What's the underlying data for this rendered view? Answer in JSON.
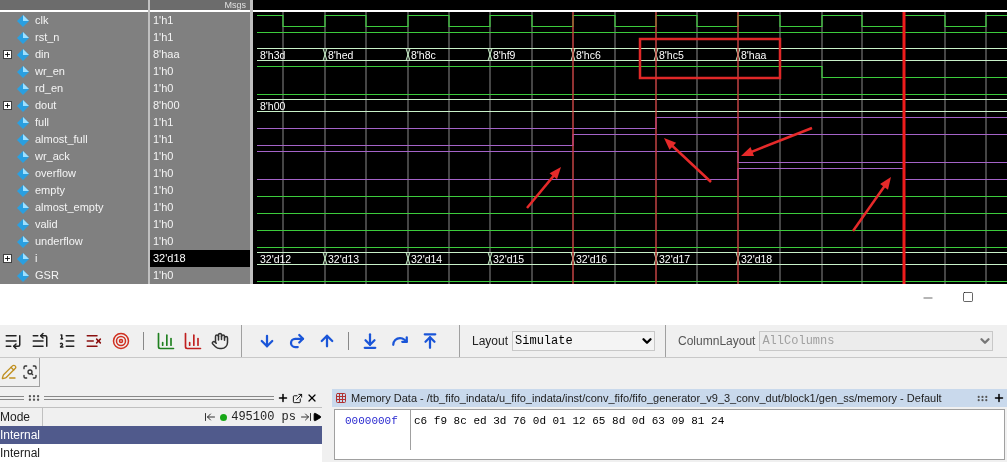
{
  "wave": {
    "header": "Msgs",
    "signals": [
      {
        "name": "clk",
        "value": "1'h1",
        "expandable": false,
        "selected": false
      },
      {
        "name": "rst_n",
        "value": "1'h1",
        "expandable": false,
        "selected": false
      },
      {
        "name": "din",
        "value": "8'haa",
        "expandable": true,
        "selected": false,
        "segments": [
          "8'h3d",
          "8'hed",
          "8'h8c",
          "8'hf9",
          "8'hc6",
          "8'hc5",
          "8'haa"
        ]
      },
      {
        "name": "wr_en",
        "value": "1'h0",
        "expandable": false,
        "selected": false
      },
      {
        "name": "rd_en",
        "value": "1'h0",
        "expandable": false,
        "selected": false
      },
      {
        "name": "dout",
        "value": "8'h00",
        "expandable": true,
        "selected": false,
        "segments": [
          "8'h00"
        ]
      },
      {
        "name": "full",
        "value": "1'h1",
        "expandable": false,
        "selected": false
      },
      {
        "name": "almost_full",
        "value": "1'h1",
        "expandable": false,
        "selected": false
      },
      {
        "name": "wr_ack",
        "value": "1'h0",
        "expandable": false,
        "selected": false
      },
      {
        "name": "overflow",
        "value": "1'h0",
        "expandable": false,
        "selected": false
      },
      {
        "name": "empty",
        "value": "1'h0",
        "expandable": false,
        "selected": false
      },
      {
        "name": "almost_empty",
        "value": "1'h0",
        "expandable": false,
        "selected": false
      },
      {
        "name": "valid",
        "value": "1'h0",
        "expandable": false,
        "selected": false
      },
      {
        "name": "underflow",
        "value": "1'h0",
        "expandable": false,
        "selected": false
      },
      {
        "name": "i",
        "value": "32'd18",
        "expandable": true,
        "selected": true,
        "segments": [
          "32'd12",
          "32'd13",
          "32'd14",
          "32'd15",
          "32'd16",
          "32'd17",
          "32'd18"
        ]
      },
      {
        "name": "GSR",
        "value": "1'h0",
        "expandable": false,
        "selected": false
      }
    ]
  },
  "toolbar": {
    "layout_label": "Layout",
    "layout_value": "Simulate",
    "column_layout_label": "ColumnLayout",
    "column_layout_value": "AllColumns",
    "column_layout_disabled": true
  },
  "left_panel": {
    "column": "Mode",
    "time": "495100 ps",
    "rows": [
      {
        "label": "Internal",
        "selected": true
      },
      {
        "label": "Internal",
        "selected": false
      }
    ]
  },
  "memory": {
    "title": "Memory Data - /tb_fifo_indata/u_fifo_indata/inst/conv_fifo/fifo_generator_v9_3_conv_dut/block1/gen_ss/memory - Default",
    "rows": [
      {
        "address": "0000000f",
        "data": "c6 f9 8c ed 3d 76 0d 01 12 65 8d 0d 63 09 81 24"
      }
    ]
  }
}
